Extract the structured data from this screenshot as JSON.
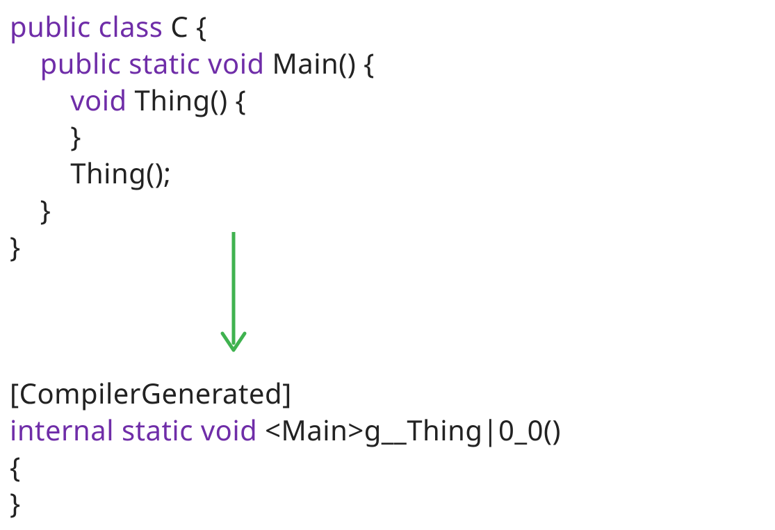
{
  "code": {
    "top": {
      "line1": {
        "kw": "public class",
        "rest": " C {"
      },
      "line2": {
        "indent": "    ",
        "kw": "public static void",
        "rest": " Main() {"
      },
      "line3": {
        "indent": "        ",
        "kw": "void",
        "rest": " Thing() {"
      },
      "line4": {
        "text": "        }"
      },
      "line5": {
        "text": "        Thing();"
      },
      "line6": {
        "text": "    }"
      },
      "line7": {
        "text": "}"
      }
    },
    "bottom": {
      "line1": {
        "text": "[CompilerGenerated]"
      },
      "line2": {
        "kw": "internal static void",
        "rest": " <Main>g__Thing|0_0()"
      },
      "line3": {
        "text": "{"
      },
      "line4": {
        "text": "}"
      }
    }
  },
  "arrow": {
    "color": "#3fb24f"
  }
}
